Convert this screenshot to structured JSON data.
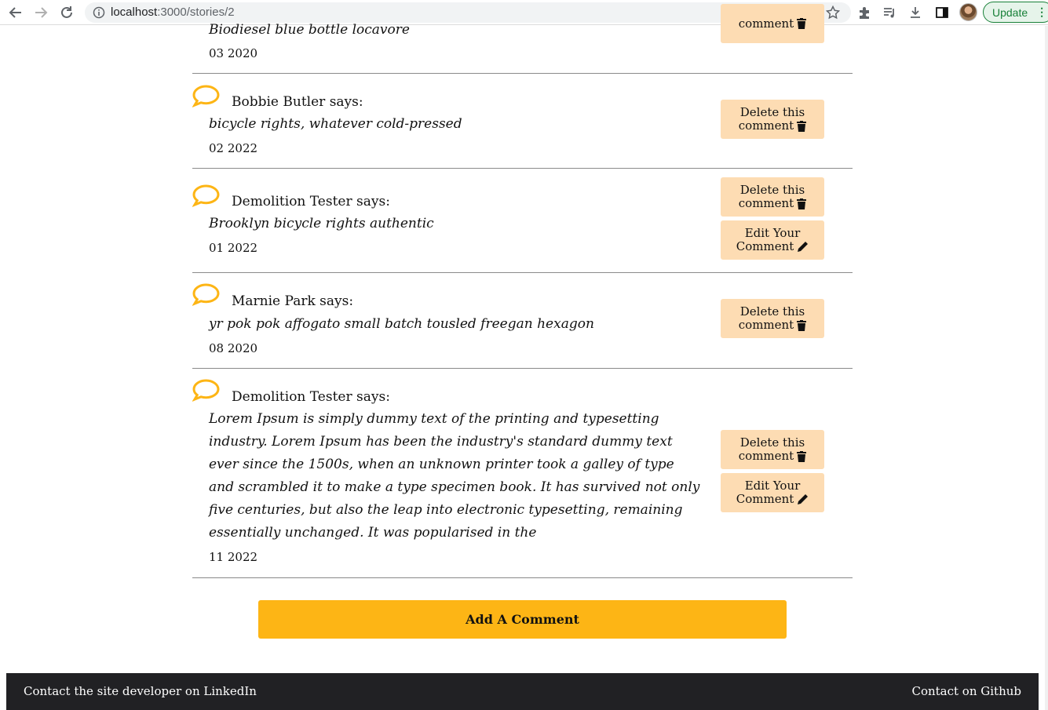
{
  "browser": {
    "url_host": "localhost",
    "url_path": ":3000/stories/2",
    "update_label": "Update"
  },
  "comments": [
    {
      "body": "Biodiesel blue bottle locavore",
      "date": "03 2020",
      "delete_line1": "",
      "delete_line2": "comment"
    },
    {
      "author": "Bobbie Butler says:",
      "body": "bicycle rights, whatever cold-pressed",
      "date": "02 2022",
      "delete_line1": "Delete this",
      "delete_line2": "comment"
    },
    {
      "author": "Demolition Tester says:",
      "body": "Brooklyn bicycle rights authentic",
      "date": "01 2022",
      "delete_line1": "Delete this",
      "delete_line2": "comment",
      "edit_line1": "Edit Your",
      "edit_line2": "Comment"
    },
    {
      "author": "Marnie Park says:",
      "body": "yr pok pok affogato small batch tousled freegan hexagon",
      "date": "08 2020",
      "delete_line1": "Delete this",
      "delete_line2": "comment"
    },
    {
      "author": "Demolition Tester says:",
      "body": "Lorem Ipsum is simply dummy text of the printing and typesetting industry. Lorem Ipsum has been the industry's standard dummy text ever since the 1500s, when an unknown printer took a galley of type and scrambled it to make a type specimen book. It has survived not only five centuries, but also the leap into electronic typesetting, remaining essentially unchanged. It was popularised in the",
      "date": "11 2022",
      "delete_line1": "Delete this",
      "delete_line2": "comment",
      "edit_line1": "Edit Your",
      "edit_line2": "Comment"
    }
  ],
  "add_comment_label": "Add A Comment",
  "footer": {
    "linkedin_label": "Contact the site developer on LinkedIn",
    "github_label": "Contact on Github"
  },
  "colors": {
    "accent": "#fdb515",
    "button_bg": "#fddcb3",
    "footer_bg": "#212124"
  }
}
